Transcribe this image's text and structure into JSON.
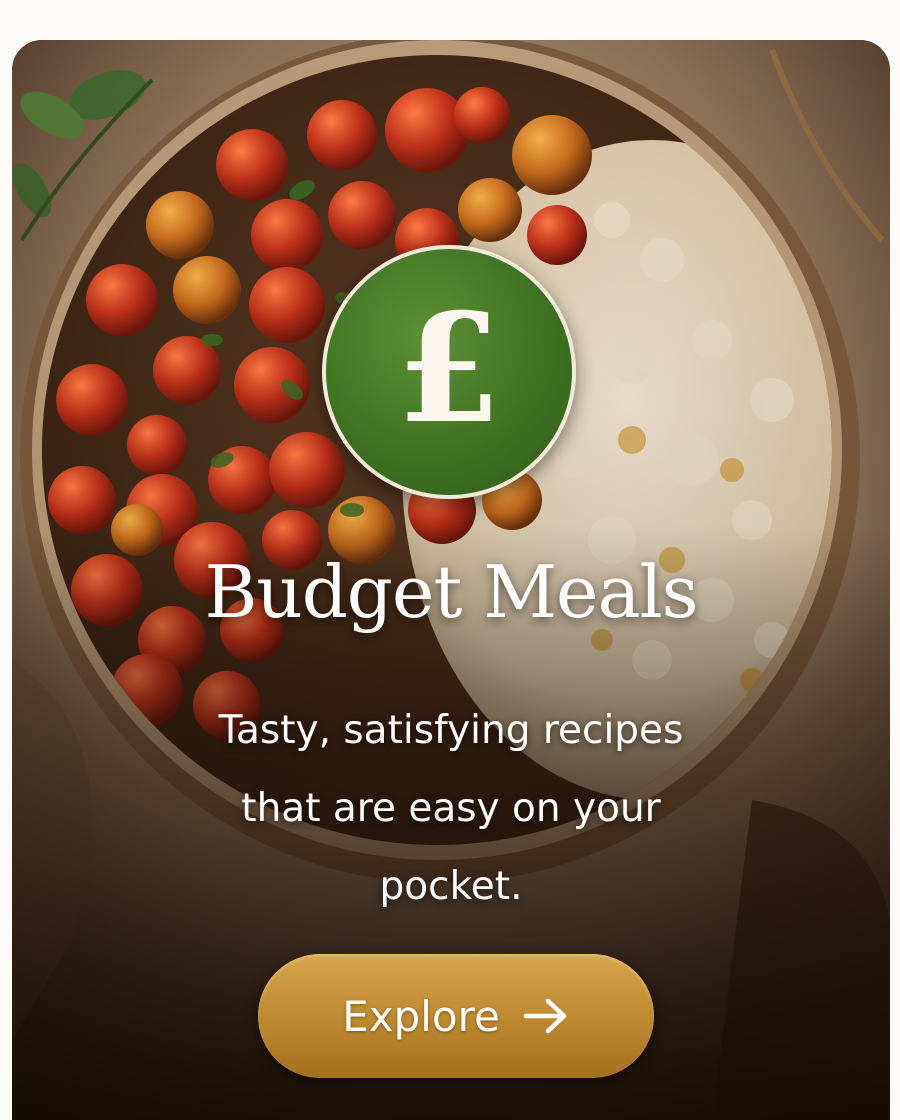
{
  "card": {
    "icon": "pound-sterling-icon",
    "badge_symbol": "£",
    "title": "Budget Meals",
    "subtitle": "Tasty, satisfying recipes that are easy on your pocket.",
    "button": {
      "label": "Explore",
      "icon": "arrow-right-icon"
    },
    "image": "bowl of roasted cherry tomatoes and rice"
  },
  "colors": {
    "badge_green": "#3f7222",
    "button_gold": "#c08b32",
    "text": "#ffffff",
    "card_dark": "#2b1a10"
  }
}
